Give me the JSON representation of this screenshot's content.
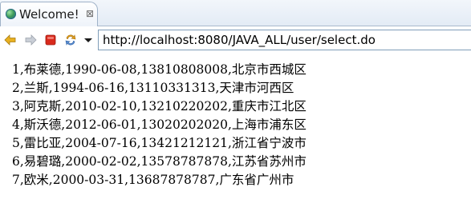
{
  "tab": {
    "title": "Welcome!",
    "close_glyph": "⊠",
    "icon": "globe-icon"
  },
  "toolbar": {
    "back_icon": "back-arrow-icon",
    "forward_icon": "forward-arrow-icon",
    "stop_icon": "stop-icon",
    "refresh_icon": "refresh-icon",
    "menu_icon": "chevron-down-icon",
    "url": "http://localhost:8080/JAVA_ALL/user/select.do"
  },
  "content": {
    "rows": [
      "1,布莱德,1990-06-08,13810808008,北京市西城区",
      "2,兰斯,1994-06-16,13110331313,天津市河西区",
      "3,阿克斯,2010-02-10,13210220202,重庆市江北区",
      "4,斯沃德,2012-06-01,13020202020,上海市浦东区",
      "5,雷比亚,2004-07-16,13421212121,浙江省宁波市",
      "6,易碧璐,2000-02-02,13578787878,江苏省苏州市",
      "7,欧米,2000-03-31,13687878787,广东省广州市"
    ]
  },
  "colors": {
    "back_arrow": "#e8b020",
    "forward_arrow": "#b9bec6",
    "stop": "#d92a1c",
    "refresh": "#e8a21c",
    "url_border": "#7f9db9"
  }
}
